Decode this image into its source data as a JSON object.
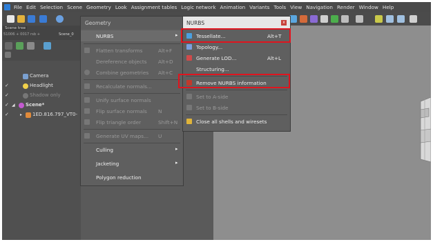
{
  "menubar": {
    "items": [
      "File",
      "Edit",
      "Selection",
      "Scene",
      "Geometry",
      "Look",
      "Assignment tables",
      "Logic network",
      "Animation",
      "Variants",
      "Tools",
      "View",
      "Navigation",
      "Render",
      "Window",
      "Help"
    ]
  },
  "scenegraph": {
    "tab_label": "Scene tree",
    "tab_path": "51006 + 0017 rsb +",
    "tab_scene": "Scene_0",
    "rows": [
      {
        "label": "Camera",
        "checked": ""
      },
      {
        "label": "Headlight",
        "checked": "✓"
      },
      {
        "label": "Shadow only",
        "checked": "✓"
      },
      {
        "label": "Scene*",
        "checked": "✓"
      },
      {
        "label": "1ED.816.797_VT0-",
        "checked": "✓"
      }
    ]
  },
  "geometry_menu": {
    "header": "Geometry",
    "items": [
      {
        "label": "NURBS",
        "shortcut": "",
        "arrow": "▸",
        "enabled": true
      },
      {
        "label": "Flatten transforms",
        "shortcut": "Alt+F",
        "arrow": "",
        "enabled": false
      },
      {
        "label": "Dereference objects",
        "shortcut": "Alt+D",
        "arrow": "",
        "enabled": false
      },
      {
        "label": "Combine geometries",
        "shortcut": "Alt+C",
        "arrow": "",
        "enabled": false
      },
      {
        "label": "Recalculate normals...",
        "shortcut": "",
        "arrow": "",
        "enabled": false
      },
      {
        "label": "Unify surface normals",
        "shortcut": "",
        "arrow": "",
        "enabled": false
      },
      {
        "label": "Flip surface normals",
        "shortcut": "N",
        "arrow": "",
        "enabled": false
      },
      {
        "label": "Flip triangle order",
        "shortcut": "Shift+N",
        "arrow": "",
        "enabled": false
      },
      {
        "label": "Generate UV maps...",
        "shortcut": "U",
        "arrow": "",
        "enabled": false
      },
      {
        "label": "Culling",
        "shortcut": "",
        "arrow": "▸",
        "enabled": true
      },
      {
        "label": "Jacketing",
        "shortcut": "",
        "arrow": "▸",
        "enabled": true
      },
      {
        "label": "Polygon reduction",
        "shortcut": "",
        "arrow": "",
        "enabled": true
      }
    ]
  },
  "nurbs_menu": {
    "header": "NURBS",
    "close": "x",
    "items": [
      {
        "label": "Tessellate...",
        "shortcut": "Alt+T",
        "enabled": true
      },
      {
        "label": "Topology...",
        "shortcut": "",
        "enabled": true
      },
      {
        "label": "Generate LOD...",
        "shortcut": "Alt+L",
        "enabled": true
      },
      {
        "label": "Structuring...",
        "shortcut": "",
        "enabled": true
      },
      {
        "label": "Remove NURBS information",
        "shortcut": "",
        "enabled": true
      },
      {
        "label": "Set to A-side",
        "shortcut": "",
        "enabled": false
      },
      {
        "label": "Set to B-side",
        "shortcut": "",
        "enabled": false
      },
      {
        "label": "Close all shells and wiresets",
        "shortcut": "",
        "enabled": true
      }
    ]
  },
  "colors": {
    "highlight_box": "#e0141e",
    "menu_bg": "#5f5f5f",
    "viewport_bg": "#8e8e8e"
  }
}
